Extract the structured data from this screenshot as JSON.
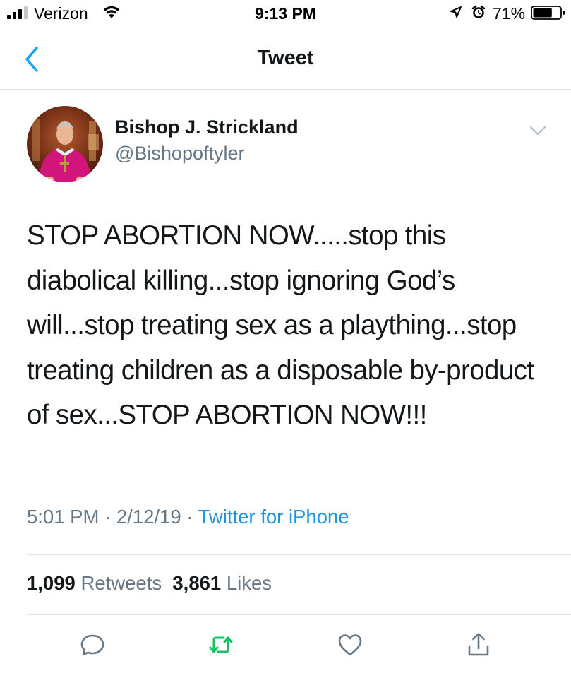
{
  "status_bar": {
    "carrier": "Verizon",
    "time": "9:13 PM",
    "battery_percent": "71%",
    "battery_level": 0.71,
    "signal_bars": 3,
    "icons": [
      "signal-icon",
      "wifi-icon",
      "location-arrow-icon",
      "alarm-icon",
      "battery-icon"
    ]
  },
  "nav": {
    "title": "Tweet",
    "back_icon": "chevron-left-icon"
  },
  "tweet": {
    "author_name": "Bishop J. Strickland",
    "author_handle": "@Bishopoftyler",
    "text": "STOP ABORTION NOW.....stop this diabolical killing...stop ignoring God’s will...stop treating sex as a plaything...stop treating children as a disposable by-product of sex...STOP ABORTION NOW!!!",
    "time": "5:01 PM",
    "sep1": " · ",
    "date": "2/12/19",
    "sep2": " · ",
    "source": "Twitter for iPhone",
    "menu_icon": "chevron-down-icon"
  },
  "stats": {
    "retweets_count": "1,099",
    "retweets_label": "Retweets",
    "likes_count": "3,861",
    "likes_label": "Likes"
  },
  "actions": {
    "icons": [
      "reply-icon",
      "retweet-icon",
      "like-icon",
      "share-icon"
    ]
  },
  "colors": {
    "link_blue": "#1b95e0",
    "ios_blue": "#1da1f2",
    "retweet_green": "#17bf63",
    "secondary_text": "#657786",
    "primary_text": "#14171a",
    "divider": "#e1e8ed"
  }
}
